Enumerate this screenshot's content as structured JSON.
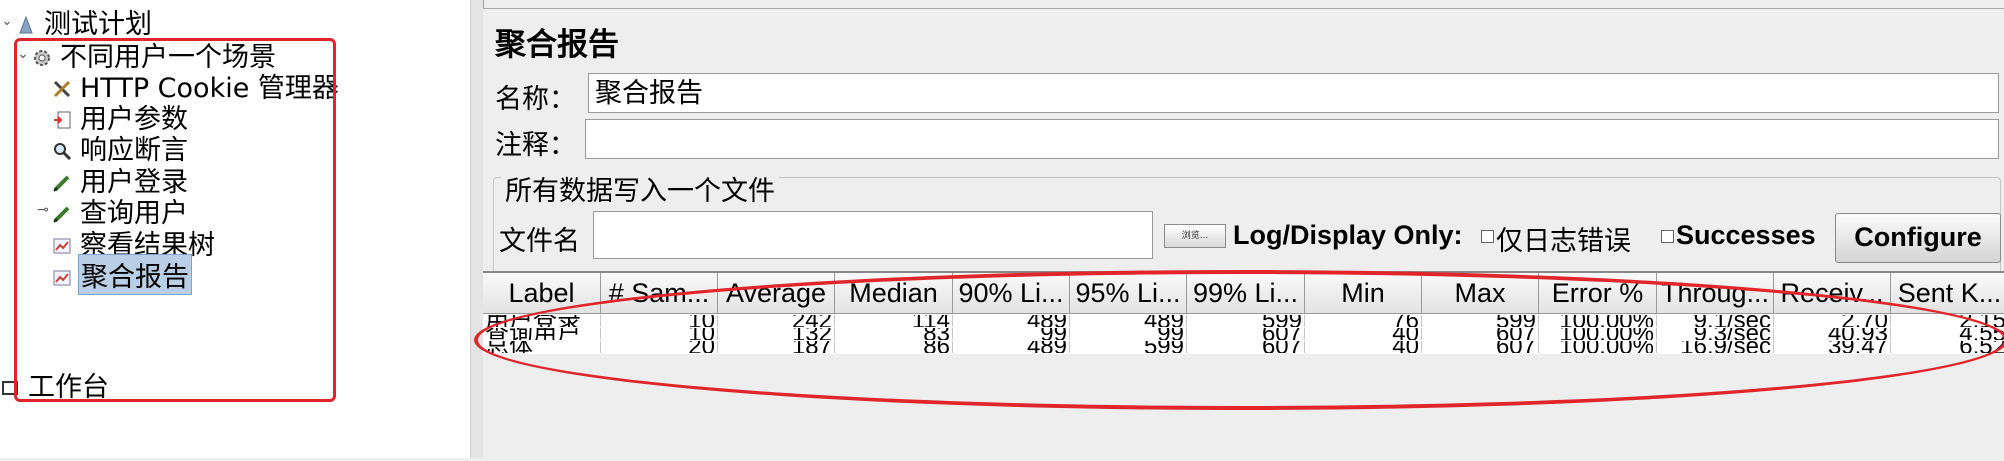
{
  "tree": {
    "items": [
      {
        "label": "测试计划",
        "icon": "test-plan-icon"
      },
      {
        "label": "不同用户一个场景",
        "icon": "thread-group-gear-icon"
      },
      {
        "label": "HTTP Cookie 管理器",
        "icon": "wrench-cross-icon"
      },
      {
        "label": "用户参数",
        "icon": "preprocessor-icon"
      },
      {
        "label": "响应断言",
        "icon": "magnifier-icon"
      },
      {
        "label": "用户登录",
        "icon": "sampler-pen-icon"
      },
      {
        "label": "查询用户",
        "icon": "sampler-pen-icon"
      },
      {
        "label": "察看结果树",
        "icon": "listener-chart-icon"
      },
      {
        "label": "聚合报告",
        "icon": "listener-chart-icon"
      },
      {
        "label": "工作台",
        "icon": "workbench-icon"
      }
    ]
  },
  "panel": {
    "title": "聚合报告",
    "name_label": "名称：",
    "name_value": "聚合报告",
    "comment_label": "注释：",
    "comment_value": ""
  },
  "file": {
    "group_title": "所有数据写入一个文件",
    "filename_label": "文件名",
    "filename_value": "",
    "browse_label": "浏览...",
    "log_display_label": "Log/Display Only:",
    "errors_only_label": "仅日志错误",
    "successes_label": "Successes",
    "configure_label": "Configure"
  },
  "table": {
    "columns": [
      "Label",
      "# Sam...",
      "Average",
      "Median",
      "90% Li...",
      "95% Li...",
      "99% Li...",
      "Min",
      "Max",
      "Error %",
      "Throug...",
      "Receiv...",
      "Sent K..."
    ],
    "rows": [
      [
        "用户登录",
        "10",
        "242",
        "114",
        "489",
        "489",
        "599",
        "76",
        "599",
        "100.00%",
        "9.1/sec",
        "2.70",
        "2.15"
      ],
      [
        "查询用户",
        "10",
        "132",
        "83",
        "99",
        "99",
        "607",
        "40",
        "607",
        "100.00%",
        "9.3/sec",
        "40.93",
        "4.55"
      ],
      [
        "总体",
        "20",
        "187",
        "86",
        "489",
        "599",
        "607",
        "40",
        "607",
        "100.00%",
        "16.9/sec",
        "39.47",
        "6.52"
      ]
    ]
  },
  "colors": {
    "annotation": "#e0262b",
    "selection": "#b8cfe5"
  }
}
